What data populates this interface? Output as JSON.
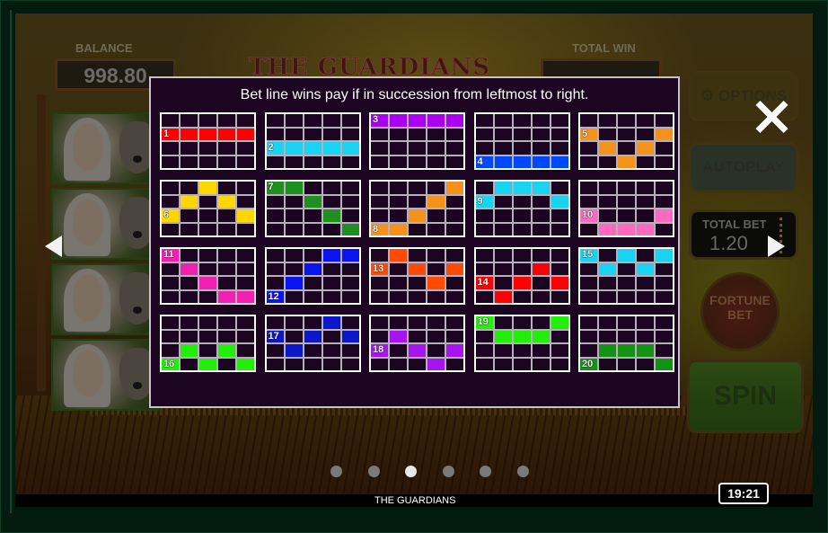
{
  "game": {
    "name": "THE GUARDIANS",
    "logo_text": "THE GUARDIANS",
    "clock": "19:21"
  },
  "hud": {
    "balance_label": "BALANCE",
    "balance_value": "998.80",
    "total_win_label": "TOTAL WIN",
    "total_win_value": "",
    "options_label": "OPTIONS",
    "autoplay_label": "AUTOPLAY",
    "total_bet_label": "TOTAL BET",
    "total_bet_value": "1.20",
    "fortune_bet_label": "FORTUNE BET",
    "spin_label": "SPIN"
  },
  "paytable": {
    "title": "Bet line wins pay if in succession from leftmost to right.",
    "grid": {
      "columns": 5,
      "rows": 4
    },
    "lines": [
      {
        "number": "1",
        "color": "#ff0000",
        "rows": [
          1,
          1,
          1,
          1,
          1
        ]
      },
      {
        "number": "2",
        "color": "#1ad3f0",
        "rows": [
          2,
          2,
          2,
          2,
          2
        ]
      },
      {
        "number": "3",
        "color": "#aa00f2",
        "rows": [
          0,
          0,
          0,
          0,
          0
        ]
      },
      {
        "number": "4",
        "color": "#0048ff",
        "rows": [
          3,
          3,
          3,
          3,
          3
        ]
      },
      {
        "number": "5",
        "color": "#f5921c",
        "rows": [
          1,
          2,
          3,
          2,
          1
        ]
      },
      {
        "number": "6",
        "color": "#ffd700",
        "rows": [
          2,
          1,
          0,
          1,
          2
        ]
      },
      {
        "number": "7",
        "color": "#1f8f1f",
        "rows": [
          0,
          0,
          1,
          2,
          3
        ]
      },
      {
        "number": "8",
        "color": "#f5921c",
        "rows": [
          3,
          3,
          2,
          1,
          0
        ]
      },
      {
        "number": "9",
        "color": "#1ad3f0",
        "rows": [
          1,
          0,
          0,
          0,
          1
        ]
      },
      {
        "number": "10",
        "color": "#ff69c0",
        "rows": [
          2,
          3,
          3,
          3,
          2
        ]
      },
      {
        "number": "11",
        "color": "#f020b0",
        "rows": [
          0,
          1,
          2,
          3,
          3
        ]
      },
      {
        "number": "12",
        "color": "#0a14f0",
        "rows": [
          3,
          2,
          1,
          0,
          0
        ]
      },
      {
        "number": "13",
        "color": "#ff4a00",
        "rows": [
          1,
          0,
          1,
          2,
          1
        ]
      },
      {
        "number": "14",
        "color": "#ff0000",
        "rows": [
          2,
          3,
          2,
          1,
          2
        ]
      },
      {
        "number": "15",
        "color": "#1ad3f0",
        "rows": [
          0,
          1,
          0,
          1,
          0
        ]
      },
      {
        "number": "16",
        "color": "#22ee0a",
        "rows": [
          3,
          2,
          3,
          2,
          3
        ]
      },
      {
        "number": "17",
        "color": "#0c18c8",
        "rows": [
          1,
          2,
          1,
          0,
          1
        ]
      },
      {
        "number": "18",
        "color": "#a814f0",
        "rows": [
          2,
          1,
          2,
          3,
          2
        ]
      },
      {
        "number": "19",
        "color": "#22ee0a",
        "rows": [
          0,
          1,
          1,
          1,
          0
        ]
      },
      {
        "number": "20",
        "color": "#149214",
        "rows": [
          3,
          2,
          2,
          2,
          3
        ]
      }
    ]
  },
  "navigation": {
    "close_icon": "close-x",
    "prev_icon": "arrow-left",
    "next_icon": "arrow-right",
    "page_count": 6,
    "current_page": 3
  },
  "colors": {
    "modal_background": "#1b0520",
    "grid_border": "#ffffff",
    "dot_active": "#e8e8e8",
    "dot_inactive": "#7a7a7a"
  }
}
